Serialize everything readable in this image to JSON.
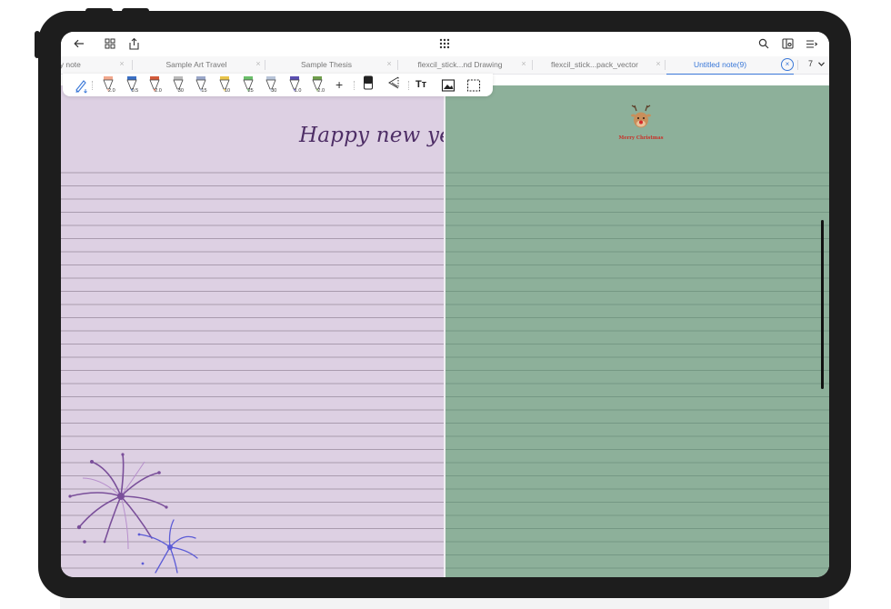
{
  "topbar": {
    "icons": [
      "back-arrow-icon",
      "grid-icon",
      "share-icon",
      "dots-grid-icon",
      "search-icon",
      "panel-icon",
      "menu-icon"
    ]
  },
  "tabs": {
    "items": [
      {
        "label": "dy note"
      },
      {
        "label": "Sample Art Travel"
      },
      {
        "label": "Sample Thesis"
      },
      {
        "label": "flexcil_stick...nd Drawing"
      },
      {
        "label": "flexcil_stick...pack_vector"
      },
      {
        "label": "Untitled note(9)",
        "active": true
      }
    ],
    "count": "7"
  },
  "toolbar": {
    "pen_sizes": [
      "2.0",
      "0.5",
      "2.0",
      "30",
      "15",
      "10",
      "25",
      "30",
      "1.0",
      "2.0"
    ],
    "pen_colors": [
      "#f2a88d",
      "#3a6fc4",
      "#d35a3a",
      "#b9b9b9",
      "#9aa7c9",
      "#e8c44a",
      "#6bbf6a",
      "#b7c4d8",
      "#5a4fb0",
      "#6f9e4c"
    ],
    "add_label": "+",
    "text_tool_label": "Tт"
  },
  "left_page": {
    "title_text": "Happy new year",
    "background": "#ddd0e3"
  },
  "right_page": {
    "sticker_text": "Merry Christmas",
    "background": "#8db09a"
  },
  "colors": {
    "accent": "#3a78d8",
    "ink": "#4e2e66"
  }
}
